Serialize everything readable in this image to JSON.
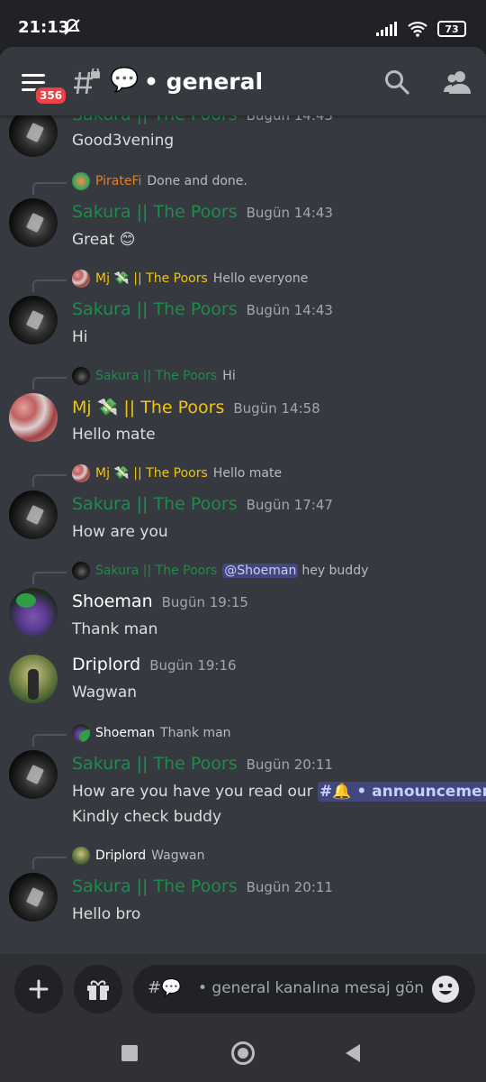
{
  "status": {
    "time": "21:13",
    "battery": "73"
  },
  "header": {
    "menu_badge": "356",
    "channel_emoji": "💬",
    "channel_name": "• general"
  },
  "messages": [
    {
      "author": "Sakura || The Poors",
      "time": "Bugün 14:43",
      "text": "Good3vening"
    },
    {
      "reply": {
        "author": "PirateFi",
        "text": "Done and done."
      },
      "author": "Sakura || The Poors",
      "time": "Bugün 14:43",
      "text": "Great 😊"
    },
    {
      "reply": {
        "author": "Mj 💸 || The Poors",
        "text": "Hello everyone"
      },
      "author": "Sakura || The Poors",
      "time": "Bugün 14:43",
      "text": "Hi"
    },
    {
      "reply": {
        "author": "Sakura || The Poors",
        "text": "Hi"
      },
      "author": "Mj 💸 || The Poors",
      "time": "Bugün 14:58",
      "text": "Hello mate"
    },
    {
      "reply": {
        "author": "Mj 💸 || The Poors",
        "text": "Hello mate"
      },
      "author": "Sakura || The Poors",
      "time": "Bugün 17:47",
      "text": "How are you"
    },
    {
      "reply": {
        "author": "Sakura || The Poors",
        "mention": "@Shoeman",
        "text": "hey buddy"
      },
      "author": "Shoeman",
      "time": "Bugün 19:15",
      "text": "Thank man"
    },
    {
      "author": "Driplord",
      "time": "Bugün 19:16",
      "text": "Wagwan"
    },
    {
      "reply": {
        "author": "Shoeman",
        "text": "Thank man"
      },
      "author": "Sakura || The Poors",
      "time": "Bugün 20:11",
      "text": "How are you have you read our",
      "channel_mention": "#🔔 • announcements",
      "text_after": "?",
      "text_line2": "Kindly check buddy"
    },
    {
      "reply": {
        "author": "Driplord",
        "text": "Wagwan"
      },
      "author": "Sakura || The Poors",
      "time": "Bugün 20:11",
      "text": "Hello bro"
    }
  ],
  "composer": {
    "prefix": "#💬",
    "placeholder": "• general kanalına mesaj gönd..."
  },
  "colors": {
    "sakura": "#1f8b4c",
    "mj": "#f1c40f",
    "pirate": "#e67e22",
    "background": "#36393f"
  },
  "icons": [
    "menu-icon",
    "hash-lock-icon",
    "search-icon",
    "members-icon",
    "plus-icon",
    "gift-icon",
    "emoji-icon"
  ]
}
